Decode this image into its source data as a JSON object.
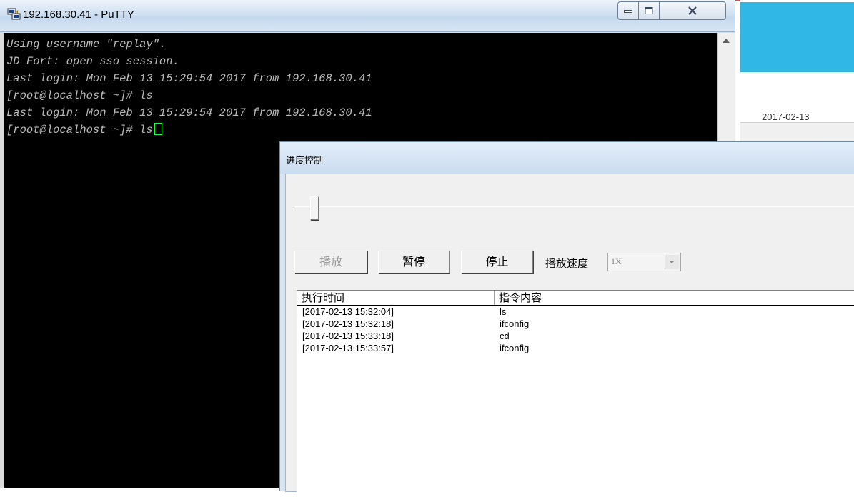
{
  "putty": {
    "title": "192.168.30.41 - PuTTY",
    "terminal_lines": [
      "Using username \"replay\".",
      "JD Fort: open sso session.",
      "Last login: Mon Feb 13 15:29:54 2017 from 192.168.30.41",
      "[root@localhost ~]# ls",
      "Last login: Mon Feb 13 15:29:54 2017 from 192.168.30.41",
      "[root@localhost ~]# ls"
    ],
    "icons": {
      "minimize": "minimize-icon",
      "maximize": "maximize-icon",
      "close": "close-icon"
    }
  },
  "background_window": {
    "date_fragment": "2017-02-13",
    "accent_color": "#31b7e5"
  },
  "dialog": {
    "title": "进度控制",
    "slider_position_fraction": 0.18,
    "buttons": {
      "play": "播放",
      "pause": "暂停",
      "stop": "停止"
    },
    "speed_label": "播放速度",
    "speed_value": "1X",
    "table": {
      "columns": [
        "执行时间",
        "指令内容"
      ],
      "rows": [
        {
          "time": "[2017-02-13 15:32:04]",
          "command": "ls"
        },
        {
          "time": "[2017-02-13 15:32:18]",
          "command": "ifconfig"
        },
        {
          "time": "[2017-02-13 15:33:18]",
          "command": "cd"
        },
        {
          "time": "[2017-02-13 15:33:57]",
          "command": "ifconfig"
        }
      ]
    }
  }
}
